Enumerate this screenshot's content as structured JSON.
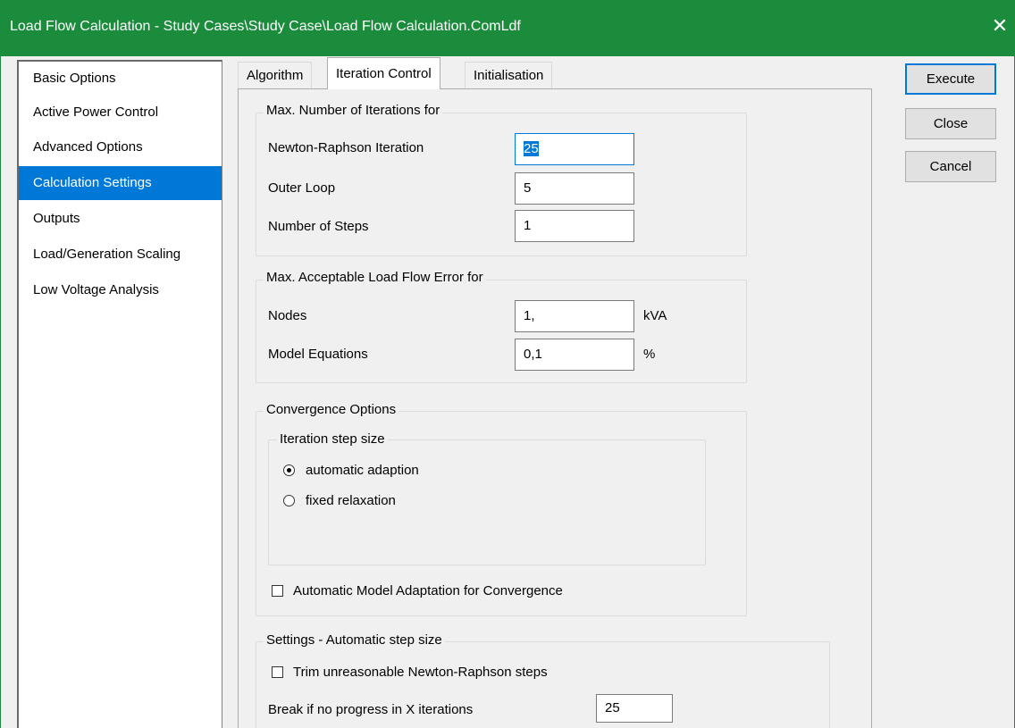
{
  "window": {
    "title": "Load Flow Calculation - Study Cases\\Study Case\\Load Flow Calculation.ComLdf",
    "close_glyph": "✕"
  },
  "nav": {
    "items": [
      {
        "label": "Basic Options"
      },
      {
        "label": "Active Power Control"
      },
      {
        "label": "Advanced Options"
      },
      {
        "label": "Calculation Settings"
      },
      {
        "label": "Outputs"
      },
      {
        "label": "Load/Generation Scaling"
      },
      {
        "label": "Low Voltage Analysis"
      }
    ],
    "selected": "Calculation Settings"
  },
  "tabs": {
    "items": [
      {
        "label": "Algorithm"
      },
      {
        "label": "Iteration Control"
      },
      {
        "label": "Initialisation"
      }
    ],
    "active": "Iteration Control"
  },
  "iterations": {
    "title": "Max. Number of Iterations for",
    "newton_label": "Newton-Raphson Iteration",
    "newton_value": "25",
    "outer_label": "Outer Loop",
    "outer_value": "5",
    "steps_label": "Number of Steps",
    "steps_value": "1"
  },
  "error": {
    "title": "Max. Acceptable Load Flow Error for",
    "nodes_label": "Nodes",
    "nodes_value": "1,",
    "nodes_unit": "kVA",
    "model_label": "Model Equations",
    "model_value": "0,1",
    "model_unit": "%"
  },
  "convergence": {
    "title": "Convergence Options",
    "step_title": "Iteration step size",
    "option_auto": "automatic adaption",
    "option_fixed": "fixed relaxation",
    "selected": "automatic adaption",
    "model_adapt_label": "Automatic Model Adaptation for Convergence",
    "model_adapt_checked": false
  },
  "auto_step": {
    "title": "Settings - Automatic step size",
    "trim_label": "Trim unreasonable Newton-Raphson steps",
    "trim_checked": false,
    "break_label": "Break if no progress in X iterations",
    "break_value": "25"
  },
  "buttons": {
    "execute": "Execute",
    "close": "Close",
    "cancel": "Cancel"
  },
  "colors": {
    "titlebar": "#1a8c3c",
    "selection": "#0078d7"
  }
}
